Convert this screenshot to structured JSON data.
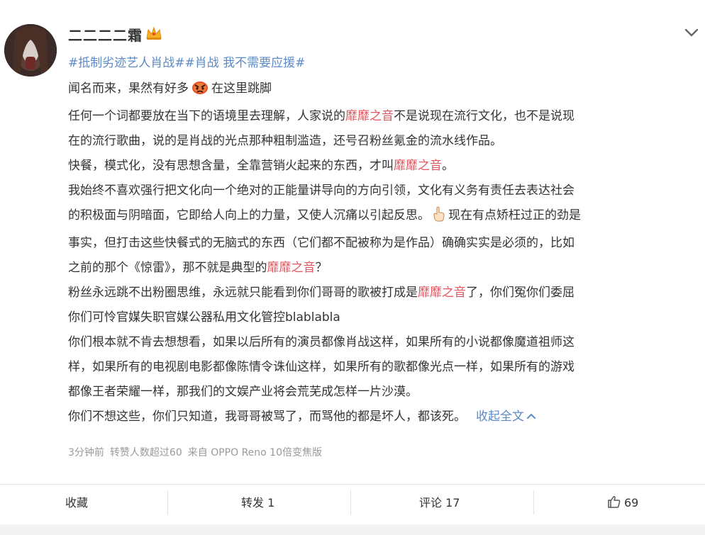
{
  "post": {
    "username": "二二二二霜",
    "topic": {
      "tag1": "#抵制劣迹艺人肖战#",
      "tag2": "#肖战 我不需要应援#"
    },
    "lines": {
      "l1a": "闻名而来，果然有好多",
      "l1b": "在这里跳脚",
      "l2a": "任何一个词都要放在当下的语境里去理解，人家说的",
      "hl": "靡靡之音",
      "l2b": "不是说现在流行文化，也不是说现",
      "l3": "在的流行歌曲，说的是肖战的光点那种粗制滥造，还号召粉丝氪金的流水线作品。",
      "l4a": "快餐，模式化，没有思想含量，全靠营销火起来的东西，才叫",
      "l4b": "。",
      "l5": "我始终不喜欢强行把文化向一个绝对的正能量讲导向的方向引领，文化有义务有责任去表达社会",
      "l6a": "的积极面与阴暗面，它即给人向上的力量，又使人沉痛以引起反思。",
      "l6b": "现在有点矫枉过正的劲是",
      "l7": "事实，但打击这些快餐式的无脑式的东西（它们都不配被称为是作品）确确实实是必须的，比如",
      "l8a": "之前的那个《惊雷》，那不就是典型的",
      "l8b": "？",
      "l9a": "粉丝永远跳不出粉圈思维，永远就只能看到你们哥哥的歌被打成是",
      "l9b": "了，你们冤你们委屈",
      "l10": "你们可怜官媒失职官媒公器私用文化管控blablabla",
      "l11": "你们根本就不肯去想想看，如果以后所有的演员都像肖战这样，如果所有的小说都像魔道祖师这",
      "l12": "样，如果所有的电视剧电影都像陈情令诛仙这样，如果所有的歌都像光点一样，如果所有的游戏",
      "l13": "都像王者荣耀一样，那我们的文娱产业将会荒芜成怎样一片沙漠。",
      "l14": "你们不想这些，你们只知道，我哥哥被骂了，而骂他的都是坏人，都该死。"
    },
    "collapse_label": "收起全文",
    "meta": {
      "time": "3分钟前",
      "reposts": "转赞人数超过60",
      "source": "来自 OPPO Reno 10倍变焦版"
    }
  },
  "actions": {
    "favorite": "收藏",
    "repost": "转发 1",
    "comment": "评论 17",
    "like_count": "69"
  },
  "colors": {
    "link": "#5a8ac8",
    "highlight": "#e0565e",
    "meta": "#9a9a9a"
  }
}
